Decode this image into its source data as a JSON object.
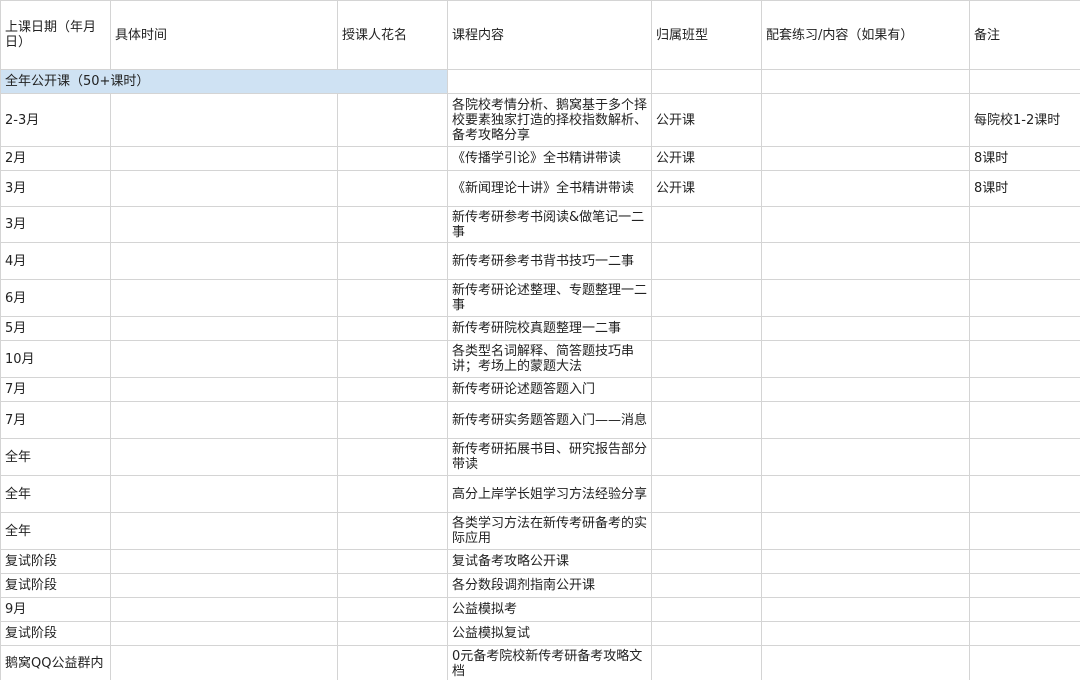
{
  "headers": [
    "上课日期（年月日）",
    "具体时间",
    "授课人花名",
    "课程内容",
    "归属班型",
    "配套练习/内容（如果有）",
    "备注"
  ],
  "section_title": "全年公开课（50+课时）",
  "rows": [
    {
      "date": "2-3月",
      "time": "",
      "teacher": "",
      "content": "各院校考情分析、鹅窝基于多个择校要素独家打造的择校指数解析、备考攻略分享",
      "class": "公开课",
      "practice": "",
      "note": "每院校1-2课时"
    },
    {
      "date": "2月",
      "time": "",
      "teacher": "",
      "content": "《传播学引论》全书精讲带读",
      "class": "公开课",
      "practice": "",
      "note": "8课时"
    },
    {
      "date": "3月",
      "time": "",
      "teacher": "",
      "content": "《新闻理论十讲》全书精讲带读",
      "class": "公开课",
      "practice": "",
      "note": "8课时"
    },
    {
      "date": "3月",
      "time": "",
      "teacher": "",
      "content": "新传考研参考书阅读&做笔记一二事",
      "class": "",
      "practice": "",
      "note": ""
    },
    {
      "date": "4月",
      "time": "",
      "teacher": "",
      "content": "新传考研参考书背书技巧一二事",
      "class": "",
      "practice": "",
      "note": ""
    },
    {
      "date": "6月",
      "time": "",
      "teacher": "",
      "content": "新传考研论述整理、专题整理一二事",
      "class": "",
      "practice": "",
      "note": ""
    },
    {
      "date": "5月",
      "time": "",
      "teacher": "",
      "content": "新传考研院校真题整理一二事",
      "class": "",
      "practice": "",
      "note": ""
    },
    {
      "date": "10月",
      "time": "",
      "teacher": "",
      "content": "各类型名词解释、简答题技巧串讲；考场上的蒙题大法",
      "class": "",
      "practice": "",
      "note": ""
    },
    {
      "date": "7月",
      "time": "",
      "teacher": "",
      "content": "新传考研论述题答题入门",
      "class": "",
      "practice": "",
      "note": ""
    },
    {
      "date": "7月",
      "time": "",
      "teacher": "",
      "content": "新传考研实务题答题入门——消息",
      "class": "",
      "practice": "",
      "note": ""
    },
    {
      "date": "全年",
      "time": "",
      "teacher": "",
      "content": "新传考研拓展书目、研究报告部分带读",
      "class": "",
      "practice": "",
      "note": ""
    },
    {
      "date": "全年",
      "time": "",
      "teacher": "",
      "content": "高分上岸学长姐学习方法经验分享",
      "class": "",
      "practice": "",
      "note": ""
    },
    {
      "date": "全年",
      "time": "",
      "teacher": "",
      "content": "各类学习方法在新传考研备考的实际应用",
      "class": "",
      "practice": "",
      "note": ""
    },
    {
      "date": "复试阶段",
      "time": "",
      "teacher": "",
      "content": "复试备考攻略公开课",
      "class": "",
      "practice": "",
      "note": ""
    },
    {
      "date": "复试阶段",
      "time": "",
      "teacher": "",
      "content": "各分数段调剂指南公开课",
      "class": "",
      "practice": "",
      "note": ""
    },
    {
      "date": "9月",
      "time": "",
      "teacher": "",
      "content": "公益模拟考",
      "class": "",
      "practice": "",
      "note": ""
    },
    {
      "date": "复试阶段",
      "time": "",
      "teacher": "",
      "content": "公益模拟复试",
      "class": "",
      "practice": "",
      "note": ""
    },
    {
      "date": "鹅窝QQ公益群内",
      "time": "",
      "teacher": "",
      "content": "0元备考院校新传考研备考攻略文档",
      "class": "",
      "practice": "",
      "note": ""
    }
  ]
}
